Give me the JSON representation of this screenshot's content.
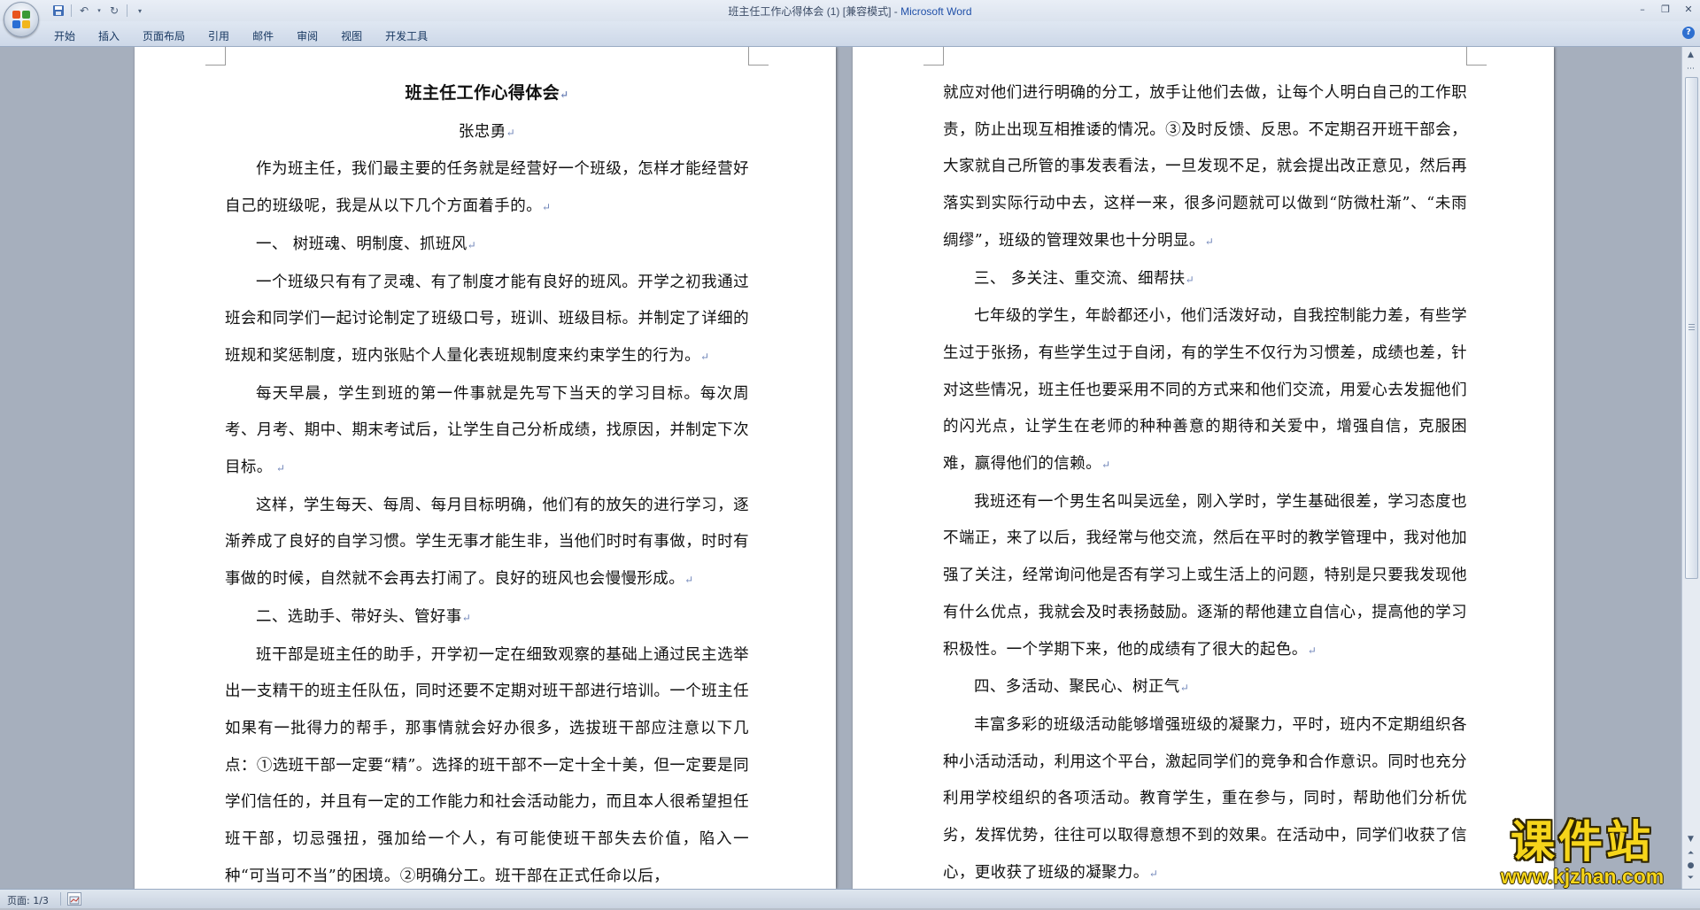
{
  "window": {
    "title": "班主任工作心得体会 (1) [兼容模式] - ",
    "app_name": "Microsoft Word"
  },
  "ribbon": {
    "tabs": [
      {
        "label": "开始"
      },
      {
        "label": "插入"
      },
      {
        "label": "页面布局"
      },
      {
        "label": "引用"
      },
      {
        "label": "邮件"
      },
      {
        "label": "审阅"
      },
      {
        "label": "视图"
      },
      {
        "label": "开发工具"
      }
    ]
  },
  "document": {
    "page_left": {
      "title": "班主任工作心得体会",
      "author": "张忠勇",
      "paragraphs": [
        "作为班主任，我们最主要的任务就是经营好一个班级，怎样才能经营好自己的班级呢，我是从以下几个方面着手的。",
        "一、  树班魂、明制度、抓班风",
        "一个班级只有有了灵魂、有了制度才能有良好的班风。开学之初我通过班会和同学们一起讨论制定了班级口号，班训、班级目标。并制定了详细的班规和奖惩制度，班内张贴个人量化表班规制度来约束学生的行为。",
        "每天早晨，学生到班的第一件事就是先写下当天的学习目标。每次周考、月考、期中、期末考试后，让学生自己分析成绩，找原因，并制定下次目标。",
        "这样，学生每天、每周、每月目标明确，他们有的放矢的进行学习，逐渐养成了良好的自学习惯。学生无事才能生非，当他们时时有事做，时时有事做的时候，自然就不会再去打闹了。良好的班风也会慢慢形成。",
        "二、选助手、带好头、管好事",
        "班干部是班主任的助手，开学初一定在细致观察的基础上通过民主选举出一支精干的班主任队伍，同时还要不定期对班干部进行培训。一个班主任如果有一批得力的帮手，那事情就会好办很多，选拔班干部应注意以下几点：①选班干部一定要“精”。选择的班干部不一定十全十美，但一定要是同学们信任的，并且有一定的工作能力和社会活动能力，而且本人很希望担任班干部，切忌强扭，强加给一个人，有可能使班干部失去价值，陷入一种“可当可不当”的困境。②明确分工。班干部在正式任命以后，"
      ]
    },
    "page_right": {
      "paragraphs": [
        "就应对他们进行明确的分工，放手让他们去做，让每个人明白自己的工作职责，防止出现互相推诿的情况。③及时反馈、反思。不定期召开班干部会，大家就自己所管的事发表看法，一旦发现不足，就会提出改正意见，然后再落实到实际行动中去，这样一来，很多问题就可以做到“防微杜渐”、“未雨绸缪”，班级的管理效果也十分明显。",
        "三、  多关注、重交流、细帮扶",
        "七年级的学生，年龄都还小，他们活泼好动，自我控制能力差，有些学生过于张扬，有些学生过于自闭，有的学生不仅行为习惯差，成绩也差，针对这些情况，班主任也要采用不同的方式来和他们交流，用爱心去发掘他们的闪光点，让学生在老师的种种善意的期待和关爱中，增强自信，克服困难，赢得他们的信赖。",
        "我班还有一个男生名叫吴远垒，刚入学时，学生基础很差，学习态度也不端正，来了以后，我经常与他交流，然后在平时的教学管理中，我对他加强了关注，经常询问他是否有学习上或生活上的问题，特别是只要我发现他有什么优点，我就会及时表扬鼓励。逐渐的帮他建立自信心，提高他的学习积极性。一个学期下来，他的成绩有了很大的起色。",
        "四、多活动、聚民心、树正气",
        "丰富多彩的班级活动能够增强班级的凝聚力，平时，班内不定期组织各种小活动活动，利用这个平台，激起同学们的竞争和合作意识。同时也充分利用学校组织的各项活动。教育学生，重在参与，同时，帮助他们分析优劣，发挥优势，往往可以取得意想不到的效果。在活动中，同学们收获了信心，更收获了班级的凝聚力。"
      ]
    }
  },
  "statusbar": {
    "page_info": "页面: 1/3"
  },
  "watermark": {
    "cn": "课件站",
    "url": "www.kjzhan.com"
  },
  "icons": {
    "office_button": "office-logo-icon",
    "qat": [
      "save-icon",
      "undo-icon",
      "redo-icon",
      "customize-qat-icon"
    ],
    "window": [
      "minimize-icon",
      "restore-icon",
      "close-icon"
    ],
    "help": "help-icon"
  },
  "colors": {
    "app_name": "#1f4fa8",
    "workspace": "#a6afbd",
    "paragraph_mark": "#6f84b8",
    "watermark": "#f6d51a"
  }
}
